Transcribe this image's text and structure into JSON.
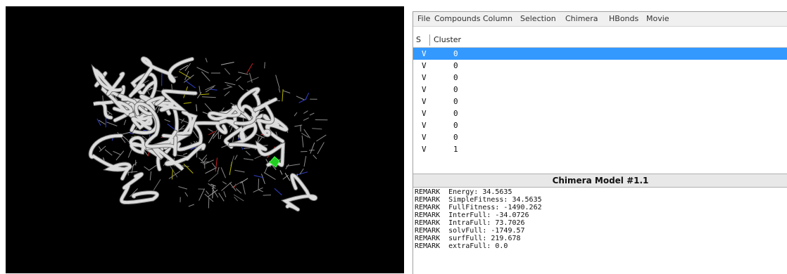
{
  "menubar": {
    "items": [
      {
        "label": "File"
      },
      {
        "label": "Compounds"
      },
      {
        "label": "Column"
      },
      {
        "label": "Selection"
      },
      {
        "label": "Chimera"
      },
      {
        "label": "HBonds"
      },
      {
        "label": "Movie"
      }
    ]
  },
  "table": {
    "headers": {
      "status": "S",
      "cluster": "Cluster"
    },
    "rows": [
      {
        "status": "V",
        "cluster": "0",
        "selected": true
      },
      {
        "status": "V",
        "cluster": "0"
      },
      {
        "status": "V",
        "cluster": "0"
      },
      {
        "status": "V",
        "cluster": "0"
      },
      {
        "status": "V",
        "cluster": "0"
      },
      {
        "status": "V",
        "cluster": "0"
      },
      {
        "status": "V",
        "cluster": "0"
      },
      {
        "status": "V",
        "cluster": "0"
      },
      {
        "status": "V",
        "cluster": "1"
      }
    ]
  },
  "model_panel": {
    "title": "Chimera Model #1.1",
    "remarks": [
      "REMARK  Energy: 34.5635",
      "REMARK  SimpleFitness: 34.5635",
      "REMARK  FullFitness: -1490.262",
      "REMARK  InterFull: -34.0726",
      "REMARK  IntraFull: 73.7026",
      "REMARK  solvFull: -1749.57",
      "REMARK  surfFull: 219.678",
      "REMARK  extraFull: 0.0"
    ]
  },
  "colors": {
    "viewport_bg": "#000000",
    "selection": "#3399ff",
    "ribbon": "#d9d9d9",
    "ligand": "#22cc22"
  }
}
